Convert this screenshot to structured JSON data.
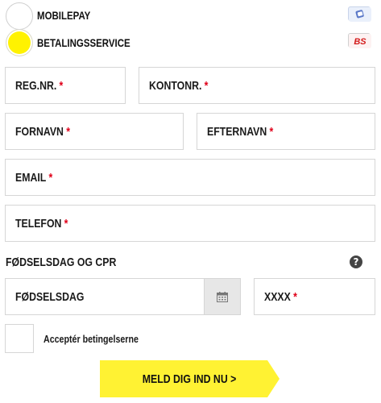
{
  "payment": {
    "options": [
      {
        "label": "MOBILEPAY",
        "selected": false,
        "logo": "mobilepay-logo"
      },
      {
        "label": "BETALINGSSERVICE",
        "selected": true,
        "logo": "betalingsservice-logo"
      }
    ]
  },
  "form": {
    "reg_nr": {
      "label": "REG.NR.",
      "required": "*"
    },
    "kontonr": {
      "label": "KONTONR.",
      "required": "*"
    },
    "fornavn": {
      "label": "FORNAVN",
      "required": "*"
    },
    "efternavn": {
      "label": "EFTERNAVN",
      "required": "*"
    },
    "email": {
      "label": "EMAIL",
      "required": "*"
    },
    "telefon": {
      "label": "TELEFON",
      "required": "*"
    },
    "birth_section_title": "FØDSELSDAG OG CPR",
    "birthday": {
      "label": "FØDSELSDAG"
    },
    "cpr": {
      "label": "XXXX",
      "required": "*"
    },
    "terms_label": "Acceptér betingelserne",
    "submit_label": "MELD DIG IND NU >"
  },
  "colors": {
    "accent": "#fff200",
    "required": "#e0001a",
    "border": "#d6d6d6"
  },
  "icons": {
    "help": "question-circle-icon",
    "calendar": "calendar-icon"
  }
}
